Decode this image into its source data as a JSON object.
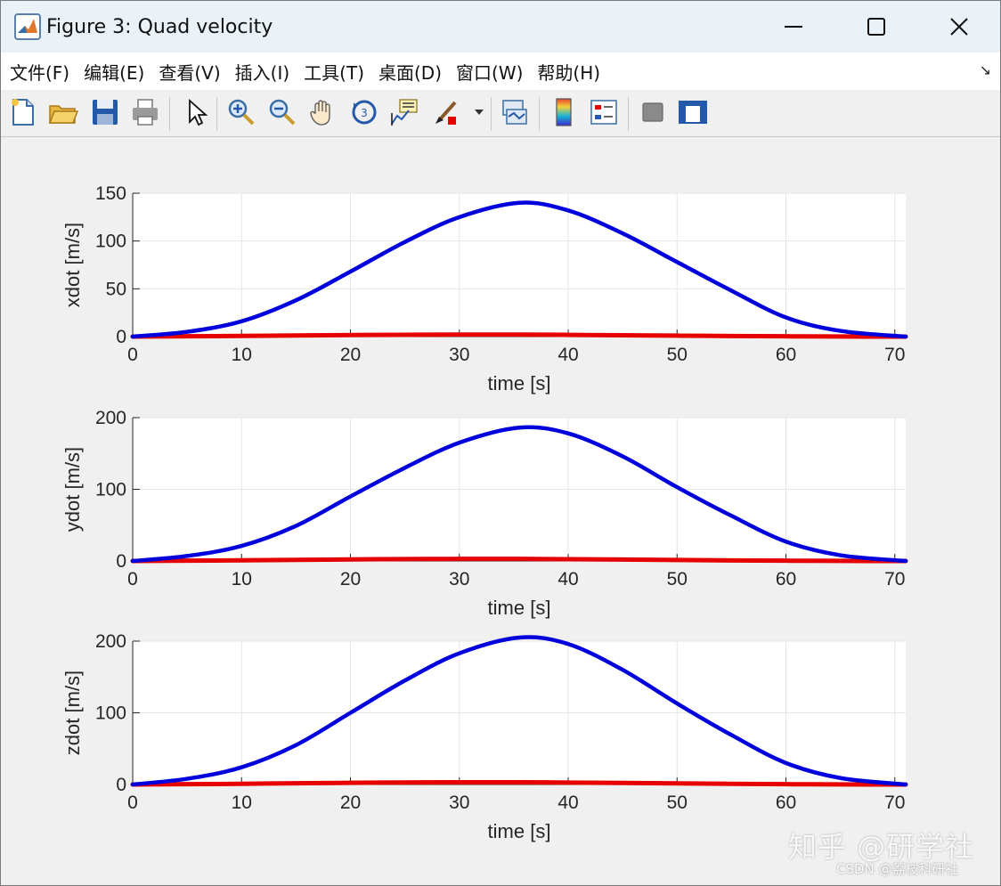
{
  "window": {
    "title": "Figure 3: Quad velocity",
    "controls": [
      "minimize",
      "maximize",
      "close"
    ]
  },
  "menu": {
    "items": [
      "文件(F)",
      "编辑(E)",
      "查看(V)",
      "插入(I)",
      "工具(T)",
      "桌面(D)",
      "窗口(W)",
      "帮助(H)"
    ],
    "overflow_glyph": "↘"
  },
  "toolbar": {
    "buttons": [
      {
        "name": "new-figure-icon"
      },
      {
        "name": "open-file-icon"
      },
      {
        "name": "save-icon"
      },
      {
        "name": "print-icon"
      },
      {
        "name": "pointer-icon"
      },
      {
        "name": "zoom-in-icon"
      },
      {
        "name": "zoom-out-icon"
      },
      {
        "name": "pan-hand-icon"
      },
      {
        "name": "rotate-3d-icon"
      },
      {
        "name": "data-cursor-icon"
      },
      {
        "name": "brush-icon"
      },
      {
        "name": "link-plot-icon"
      },
      {
        "name": "colorbar-icon"
      },
      {
        "name": "legend-icon"
      },
      {
        "name": "hide-plot-tools-icon"
      },
      {
        "name": "show-plot-tools-icon"
      }
    ]
  },
  "colors": {
    "series_blue": "#0000dd",
    "series_red": "#e60000",
    "grid": "#e6e6e6",
    "axes_bg": "#ffffff",
    "figure_bg": "#f0f0f0"
  },
  "watermark": {
    "line1": "知乎 @研学社",
    "line2": "CSDN @荔枝科研社"
  },
  "chart_data": [
    {
      "type": "line",
      "xlabel": "time [s]",
      "ylabel": "xdot [m/s]",
      "xlim": [
        0,
        71
      ],
      "ylim": [
        0,
        150
      ],
      "xticks": [
        0,
        10,
        20,
        30,
        40,
        50,
        60,
        70
      ],
      "yticks": [
        0,
        50,
        100,
        150
      ],
      "grid": true,
      "x": [
        0,
        5,
        10,
        15,
        20,
        25,
        30,
        35.5,
        40,
        45,
        50,
        55,
        60,
        65,
        71
      ],
      "series": [
        {
          "color": "#0000dd",
          "values": [
            0,
            5,
            16,
            38,
            68,
            99,
            125,
            140,
            132,
            108,
            78,
            48,
            20,
            6,
            0
          ]
        },
        {
          "color": "#e60000",
          "values": [
            0,
            0.3,
            0.7,
            1.2,
            1.6,
            1.9,
            2.1,
            2.1,
            1.8,
            1.4,
            1,
            0.6,
            0.3,
            0.1,
            0
          ]
        }
      ]
    },
    {
      "type": "line",
      "xlabel": "time [s]",
      "ylabel": "ydot [m/s]",
      "xlim": [
        0,
        71
      ],
      "ylim": [
        0,
        200
      ],
      "xticks": [
        0,
        10,
        20,
        30,
        40,
        50,
        60,
        70
      ],
      "yticks": [
        0,
        100,
        200
      ],
      "grid": true,
      "x": [
        0,
        5,
        10,
        15,
        20,
        25,
        30,
        35.5,
        40,
        45,
        50,
        55,
        60,
        65,
        71
      ],
      "series": [
        {
          "color": "#0000dd",
          "values": [
            0,
            7,
            21,
            49,
            90,
            130,
            165,
            186,
            178,
            146,
            103,
            63,
            27,
            8,
            0
          ]
        },
        {
          "color": "#e60000",
          "values": [
            0,
            0.4,
            1,
            1.6,
            2.2,
            2.6,
            2.9,
            2.9,
            2.5,
            2,
            1.4,
            0.8,
            0.4,
            0.1,
            0
          ]
        }
      ]
    },
    {
      "type": "line",
      "xlabel": "time [s]",
      "ylabel": "zdot [m/s]",
      "xlim": [
        0,
        71
      ],
      "ylim": [
        0,
        200
      ],
      "xticks": [
        0,
        10,
        20,
        30,
        40,
        50,
        60,
        70
      ],
      "yticks": [
        0,
        100,
        200
      ],
      "grid": true,
      "x": [
        0,
        5,
        10,
        15,
        20,
        25,
        30,
        35.5,
        40,
        45,
        50,
        55,
        60,
        65,
        71
      ],
      "series": [
        {
          "color": "#0000dd",
          "values": [
            0,
            8,
            24,
            55,
            100,
            145,
            183,
            205,
            196,
            160,
            113,
            69,
            30,
            9,
            0
          ]
        },
        {
          "color": "#e60000",
          "values": [
            0,
            0.4,
            1,
            1.7,
            2.3,
            2.8,
            3.1,
            3.1,
            2.7,
            2.1,
            1.5,
            0.9,
            0.4,
            0.1,
            0
          ]
        }
      ]
    }
  ]
}
